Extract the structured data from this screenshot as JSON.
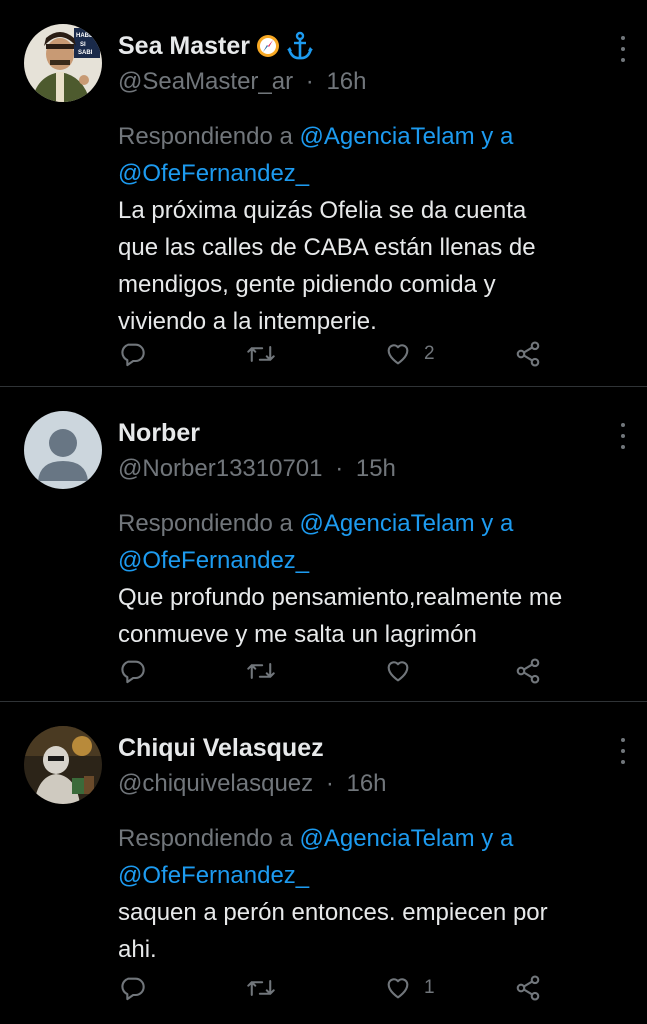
{
  "colors": {
    "background": "#000000",
    "text": "#e7e9ea",
    "muted": "#71767b",
    "mention": "#1d9bf0",
    "divider": "#2f3336"
  },
  "tweets": [
    {
      "name": "Sea Master",
      "emojis": [
        "compass-emoji",
        "anchor-emoji"
      ],
      "handle": "@SeaMaster_ar",
      "separator": "·",
      "time": "16h",
      "replying_prefix": "Respondiendo a",
      "mention1": "@AgenciaTelam",
      "connector": "y a",
      "mention2": "@OfeFernandez_",
      "text": "La próxima quizás Ofelia se da cuenta\nque las calles de CABA están llenas de\nmendigos, gente pidiendo comida y\nviviendo a la intemperie.",
      "likes": "2",
      "retweets": "",
      "replies": ""
    },
    {
      "name": "Norber",
      "handle": "@Norber13310701",
      "separator": "·",
      "time": "15h",
      "replying_prefix": "Respondiendo a",
      "mention1": "@AgenciaTelam",
      "connector": "y a",
      "mention2": "@OfeFernandez_",
      "text": "Que profundo pensamiento,realmente me\nconmueve y me salta un lagrimón",
      "likes": "",
      "retweets": "",
      "replies": ""
    },
    {
      "name": "Chiqui Velasquez",
      "handle": "@chiquivelasquez",
      "separator": "·",
      "time": "16h",
      "replying_prefix": "Respondiendo a",
      "mention1": "@AgenciaTelam",
      "connector": "y a",
      "mention2": "@OfeFernandez_",
      "text": "saquen a perón entonces. empiecen por\nahi.",
      "likes": "1",
      "retweets": "",
      "replies": ""
    }
  ]
}
